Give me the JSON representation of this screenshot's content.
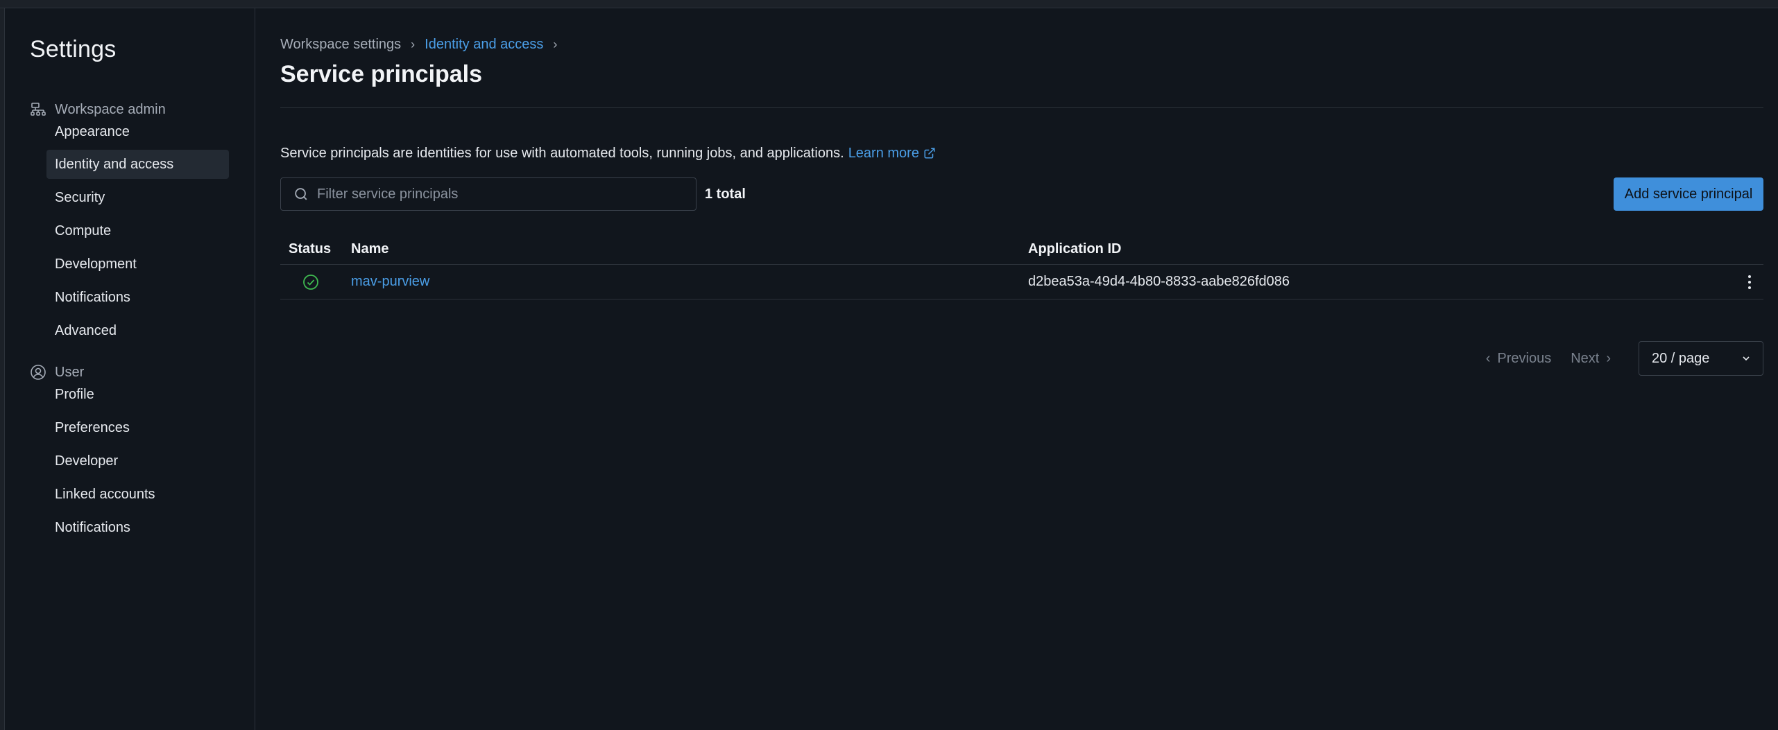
{
  "sidebar": {
    "title": "Settings",
    "sections": [
      {
        "header": "Workspace admin",
        "icon": "workspace-admin-icon",
        "items": [
          "Appearance",
          "Identity and access",
          "Security",
          "Compute",
          "Development",
          "Notifications",
          "Advanced"
        ]
      },
      {
        "header": "User",
        "icon": "user-circle-icon",
        "items": [
          "Profile",
          "Preferences",
          "Developer",
          "Linked accounts",
          "Notifications"
        ]
      }
    ],
    "active_item": "Identity and access"
  },
  "breadcrumb": {
    "items": [
      "Workspace settings",
      "Identity and access"
    ]
  },
  "page": {
    "title": "Service principals",
    "description": "Service principals are identities for use with automated tools, running jobs, and applications.",
    "learn_more": "Learn more"
  },
  "search": {
    "placeholder": "Filter service principals",
    "value": ""
  },
  "total_label": "1 total",
  "add_button_label": "Add service principal",
  "table": {
    "columns": [
      "Status",
      "Name",
      "Application ID"
    ],
    "rows": [
      {
        "status": "active",
        "name": "mav-purview",
        "application_id": "d2bea53a-49d4-4b80-8833-aabe826fd086"
      }
    ]
  },
  "pagination": {
    "previous": "Previous",
    "next": "Next",
    "page_size": "20 / page"
  },
  "colors": {
    "accent": "#3f8fdb",
    "link": "#4b9fe8",
    "success": "#3fb950",
    "background": "#11161d"
  }
}
